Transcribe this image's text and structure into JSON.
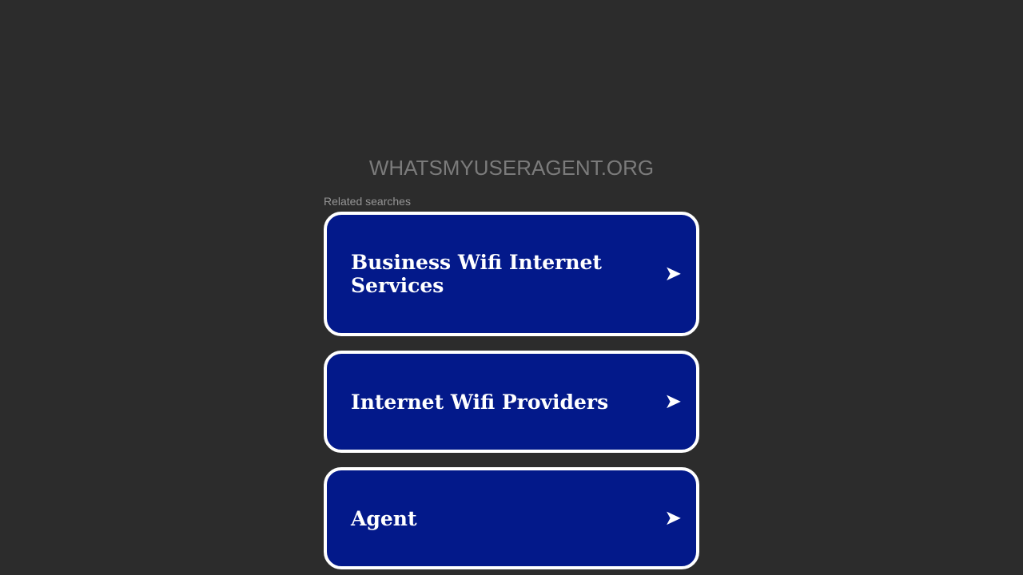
{
  "header": {
    "site_title": "WHATSMYUSERAGENT.ORG"
  },
  "related": {
    "label": "Related searches",
    "items": [
      {
        "label": "Business Wifi Internet Services",
        "icon": "arrow-right-icon"
      },
      {
        "label": "Internet Wifi Providers",
        "icon": "arrow-right-icon"
      },
      {
        "label": "Agent",
        "icon": "arrow-right-icon"
      }
    ]
  },
  "colors": {
    "background": "#2c2c2c",
    "card": "#03198a",
    "card_border": "#ffffff",
    "title": "#7b7b7b"
  }
}
